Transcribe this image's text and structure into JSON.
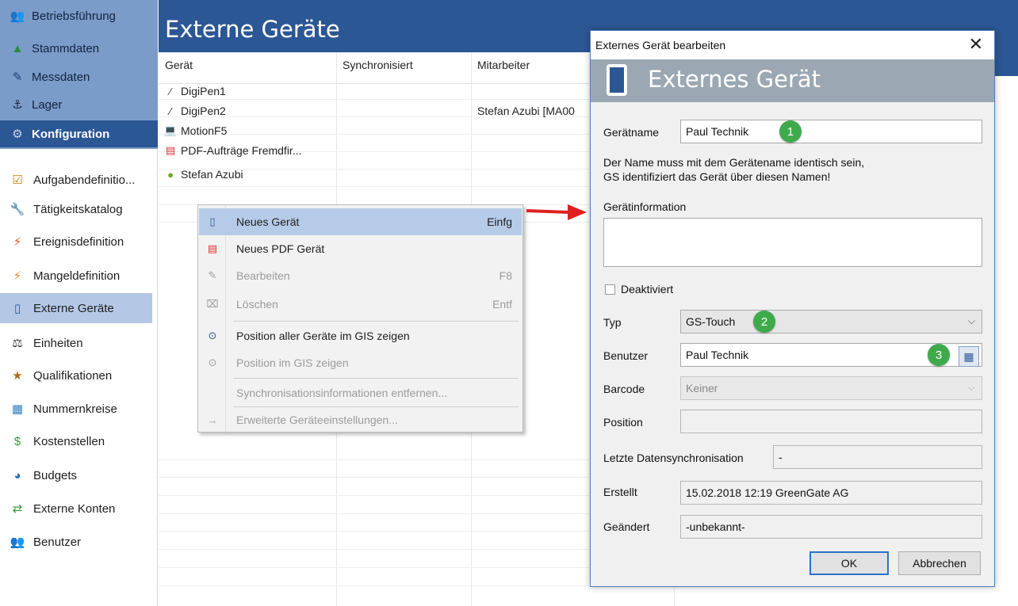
{
  "sidebar": {
    "top_items": [
      {
        "label": "Betriebsführung",
        "icon": "management-icon",
        "active": false
      },
      {
        "label": "Stammdaten",
        "icon": "master-data-icon",
        "active": false
      },
      {
        "label": "Messdaten",
        "icon": "measure-pin-icon",
        "active": false
      },
      {
        "label": "Lager",
        "icon": "warehouse-icon",
        "active": false
      },
      {
        "label": "Konfiguration",
        "icon": "gear-icon",
        "active": true
      }
    ],
    "items": [
      {
        "label": "Aufgabendefinitio...",
        "icon": "checklist-icon"
      },
      {
        "label": "Tätigkeitskatalog",
        "icon": "wrench-icon"
      },
      {
        "label": "Ereignisdefinition",
        "icon": "lightning-icon"
      },
      {
        "label": "Mangeldefinition",
        "icon": "defect-icon"
      },
      {
        "label": "Externe Geräte",
        "icon": "tablet-icon",
        "active": true
      },
      {
        "label": "Einheiten",
        "icon": "weight-icon"
      },
      {
        "label": "Qualifikationen",
        "icon": "qualification-icon"
      },
      {
        "label": "Nummernkreise",
        "icon": "number-range-icon"
      },
      {
        "label": "Kostenstellen",
        "icon": "cost-center-icon"
      },
      {
        "label": "Budgets",
        "icon": "budget-icon"
      },
      {
        "label": "Externe Konten",
        "icon": "accounts-icon"
      },
      {
        "label": "Benutzer",
        "icon": "users-icon"
      }
    ]
  },
  "main": {
    "title": "Externe Geräte",
    "columns": [
      "Gerät",
      "Synchronisiert",
      "Mitarbeiter"
    ],
    "rows": [
      {
        "device": "DigiPen1",
        "icon": "pen-icon",
        "sync": "",
        "employee": ""
      },
      {
        "device": "DigiPen2",
        "icon": "pen-icon",
        "sync": "",
        "employee": "Stefan Azubi [MA00"
      },
      {
        "device": "MotionF5",
        "icon": "laptop-icon",
        "sync": "",
        "employee": ""
      },
      {
        "device": "PDF-Aufträge Fremdfir...",
        "icon": "pdf-icon",
        "sync": "",
        "employee": ""
      },
      {
        "device": "Stefan Azubi",
        "icon": "android-icon",
        "sync": "",
        "employee": ""
      }
    ]
  },
  "context_menu": {
    "items": [
      {
        "label": "Neues Gerät",
        "shortcut": "Einfg",
        "icon": "tablet-icon",
        "enabled": true,
        "highlighted": true
      },
      {
        "label": "Neues PDF Gerät",
        "shortcut": "",
        "icon": "pdf-icon",
        "enabled": true
      },
      {
        "label": "Bearbeiten",
        "shortcut": "F8",
        "icon": "edit-icon",
        "enabled": false
      },
      {
        "label": "Löschen",
        "shortcut": "Entf",
        "icon": "delete-icon",
        "enabled": false
      },
      {
        "label": "Position aller Geräte im GIS zeigen",
        "shortcut": "",
        "icon": "gis-all-icon",
        "enabled": true
      },
      {
        "label": "Position im GIS zeigen",
        "shortcut": "",
        "icon": "gis-icon",
        "enabled": false
      },
      {
        "label": "Synchronisationsinformationen entfernen...",
        "shortcut": "",
        "icon": "",
        "enabled": false
      },
      {
        "label": "Erweiterte Geräteeinstellungen...",
        "shortcut": "",
        "icon": "settings-advanced-icon",
        "enabled": false
      }
    ]
  },
  "dialog": {
    "window_title": "Externes Gerät bearbeiten",
    "banner_title": "Externes Gerät",
    "fields": {
      "geraetname_label": "Gerätname",
      "geraetname_value": "Paul Technik",
      "hint_line1": "Der Name muss mit dem Gerätename identisch sein,",
      "hint_line2": "GS identifiziert das Gerät über diesen Namen!",
      "info_label": "Gerätinformation",
      "info_value": "",
      "deaktiviert_label": "Deaktiviert",
      "deaktiviert_checked": false,
      "typ_label": "Typ",
      "typ_value": "GS-Touch",
      "benutzer_label": "Benutzer",
      "benutzer_value": "Paul Technik",
      "barcode_label": "Barcode",
      "barcode_value": "Keiner",
      "position_label": "Position",
      "position_value": "",
      "sync_label": "Letzte Datensynchronisation",
      "sync_value": "-",
      "erstellt_label": "Erstellt",
      "erstellt_value": "15.02.2018 12:19 GreenGate AG",
      "geaendert_label": "Geändert",
      "geaendert_value": "-unbekannt-"
    },
    "badges": [
      "1",
      "2",
      "3"
    ],
    "ok_label": "OK",
    "cancel_label": "Abbrechen"
  },
  "colors": {
    "header_blue": "#2c5795",
    "sidebar_top": "#7b9bc9",
    "active_item": "#b4c8e6",
    "menu_highlight": "#b6cbe8",
    "badge_green": "#3faa4b",
    "banner_gray": "#9ba8b3",
    "arrow_red": "#e02020"
  }
}
